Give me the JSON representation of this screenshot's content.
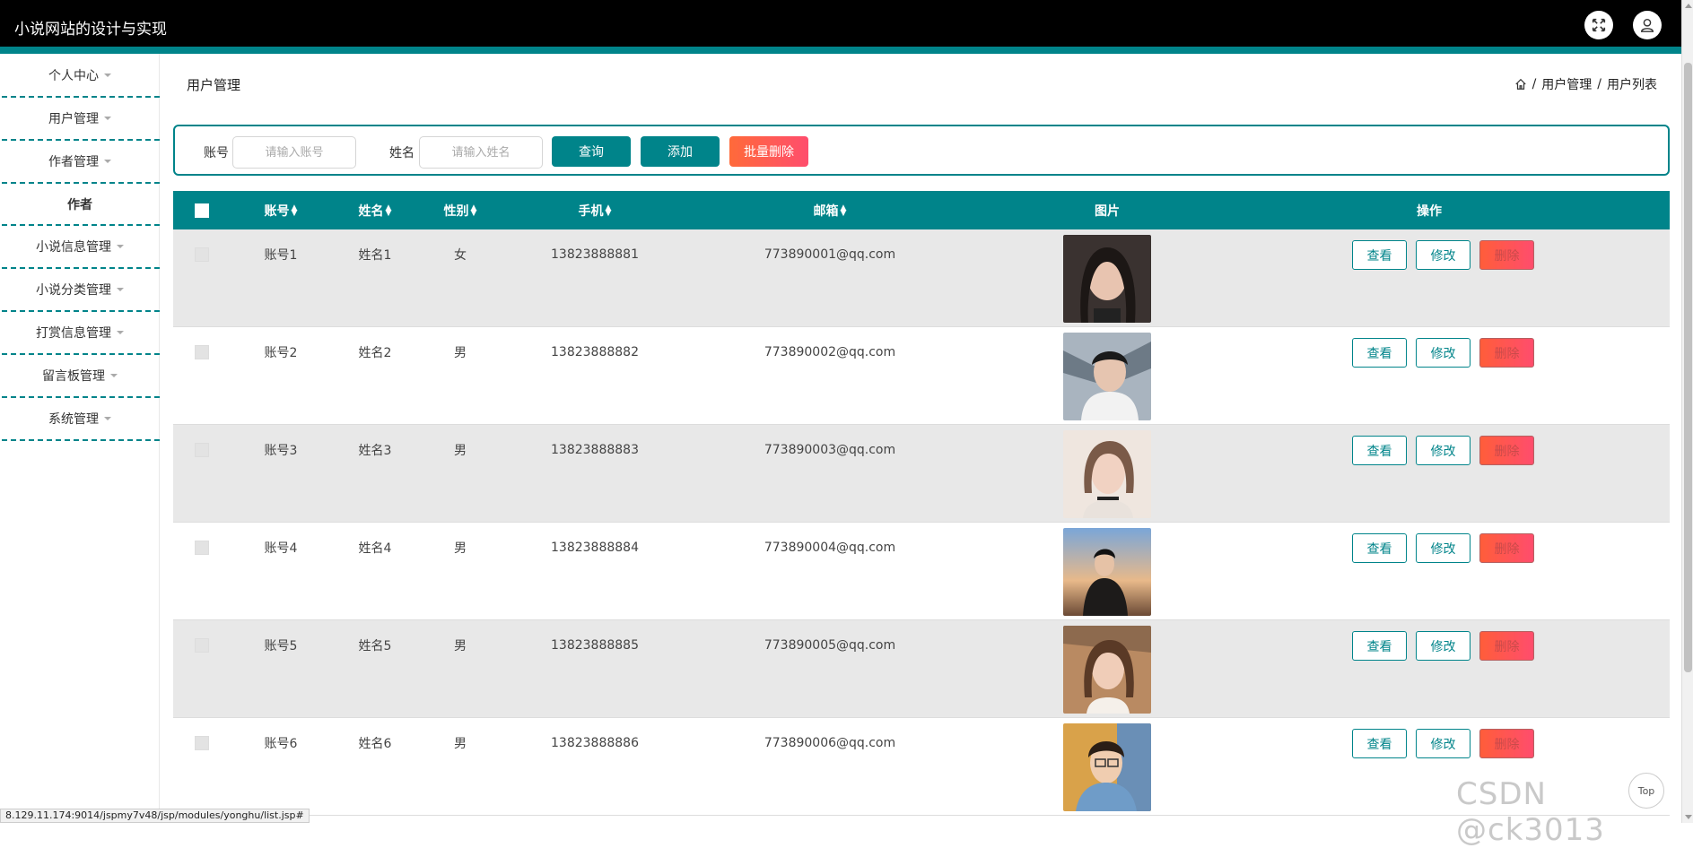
{
  "app": {
    "title": "小说网站的设计与实现"
  },
  "header_icons": [
    {
      "name": "fullscreen-icon"
    },
    {
      "name": "user-icon"
    }
  ],
  "sidebar": {
    "items": [
      {
        "label": "个人中心",
        "has_caret": true
      },
      {
        "label": "用户管理",
        "has_caret": true
      },
      {
        "label": "作者管理",
        "has_caret": true
      },
      {
        "label": "作者",
        "has_caret": false,
        "sub": true
      },
      {
        "label": "小说信息管理",
        "has_caret": true
      },
      {
        "label": "小说分类管理",
        "has_caret": true
      },
      {
        "label": "打赏信息管理",
        "has_caret": true
      },
      {
        "label": "留言板管理",
        "has_caret": true
      },
      {
        "label": "系统管理",
        "has_caret": true
      }
    ]
  },
  "page": {
    "title": "用户管理",
    "breadcrumb": {
      "sep": "/",
      "level1": "用户管理",
      "level2": "用户列表"
    }
  },
  "search": {
    "account_label": "账号",
    "account_placeholder": "请输入账号",
    "name_label": "姓名",
    "name_placeholder": "请输入姓名",
    "query_button": "查询",
    "add_button": "添加",
    "batch_delete_button": "批量删除"
  },
  "table": {
    "columns": {
      "account": "账号",
      "name": "姓名",
      "gender": "性别",
      "phone": "手机",
      "email": "邮箱",
      "photo": "图片",
      "actions": "操作"
    },
    "action_labels": {
      "view": "查看",
      "edit": "修改",
      "delete": "删除"
    },
    "rows": [
      {
        "account": "账号1",
        "name": "姓名1",
        "gender": "女",
        "phone": "13823888881",
        "email": "773890001@qq.com"
      },
      {
        "account": "账号2",
        "name": "姓名2",
        "gender": "男",
        "phone": "13823888882",
        "email": "773890002@qq.com"
      },
      {
        "account": "账号3",
        "name": "姓名3",
        "gender": "男",
        "phone": "13823888883",
        "email": "773890003@qq.com"
      },
      {
        "account": "账号4",
        "name": "姓名4",
        "gender": "男",
        "phone": "13823888884",
        "email": "773890004@qq.com"
      },
      {
        "account": "账号5",
        "name": "姓名5",
        "gender": "男",
        "phone": "13823888885",
        "email": "773890005@qq.com"
      },
      {
        "account": "账号6",
        "name": "姓名6",
        "gender": "男",
        "phone": "13823888886",
        "email": "773890006@qq.com"
      }
    ]
  },
  "status_bar": {
    "url": "8.129.11.174:9014/jspmy7v48/jsp/modules/yonghu/list.jsp#"
  },
  "back_to_top": "Top",
  "watermark": "CSDN @ck3013",
  "colors": {
    "accent": "#00848a",
    "danger": "#ff4d6d",
    "header_bg": "#000000"
  }
}
